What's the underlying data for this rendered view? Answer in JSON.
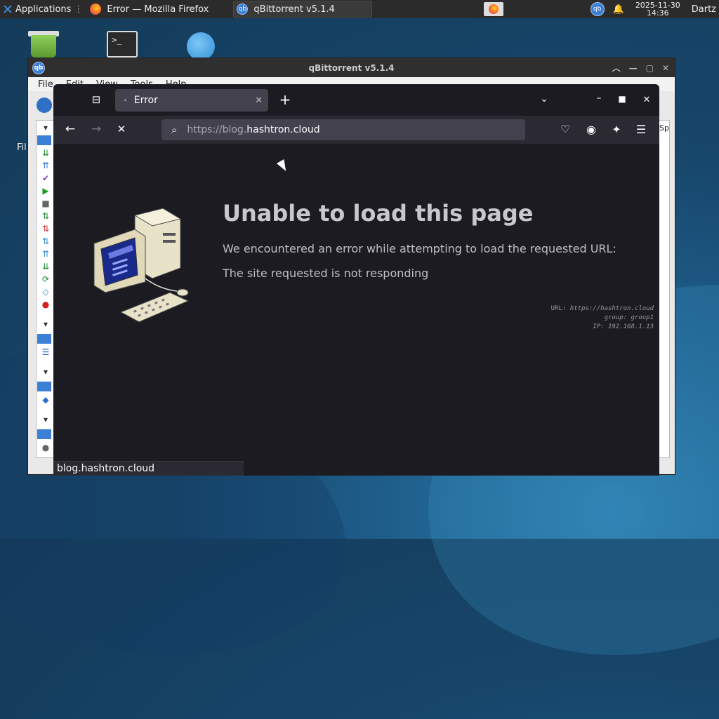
{
  "panel": {
    "apps_label": "Applications",
    "tasks": [
      {
        "label": "Error — Mozilla Firefox",
        "icon": "firefox-icon"
      },
      {
        "label": "qBittorrent v5.1.4",
        "icon": "qbittorrent-icon"
      }
    ],
    "date": "2025-11-30",
    "time": "14:36",
    "user": "Dartz"
  },
  "desktop": {
    "label_fragment": "Fil"
  },
  "qbittorrent": {
    "title": "qBittorrent v5.1.4",
    "menu": [
      "File",
      "Edit",
      "View",
      "Tools",
      "Help"
    ],
    "right_fragment": "Sp"
  },
  "firefox": {
    "tab_title": "Error",
    "url_prefix": "https://blog.",
    "url_host": "hashtron.cloud",
    "error_title": "Unable to load this page",
    "error_description": "We encountered an error while attempting to load the requested URL:",
    "error_detail": "The site requested is not responding",
    "meta": {
      "url_label": "URL:",
      "url_value": "https://hashtron.cloud",
      "group_label": "group:",
      "group_value": "group1",
      "ip_label": "IP:",
      "ip_value": "192.168.1.13"
    },
    "status_text": "blog.hashtron.cloud"
  },
  "colors": {
    "firefox_bg": "#1c1b22",
    "toolbar_bg": "#2b2a33",
    "urlbar_bg": "#42414d",
    "qb_blue": "#3c7fd6"
  }
}
